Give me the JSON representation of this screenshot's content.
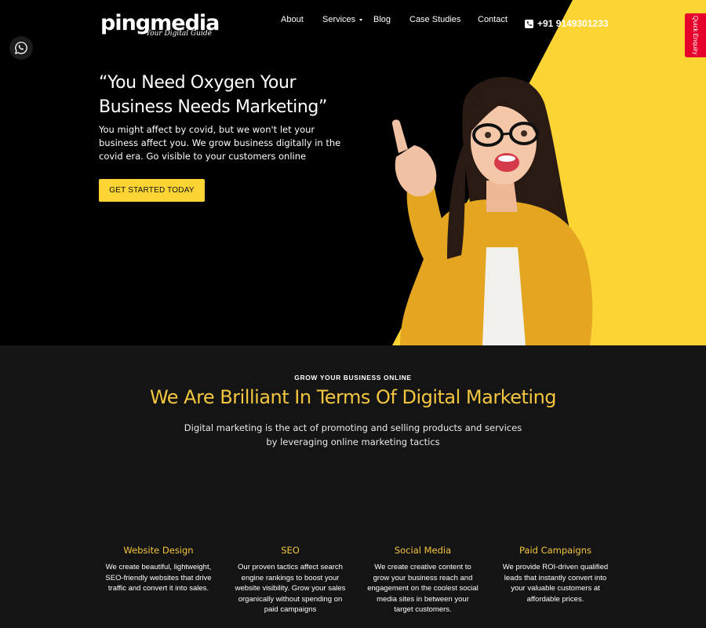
{
  "brand": {
    "name": "pingmedia",
    "tagline": "Your Digital Guide"
  },
  "nav": {
    "about": "About",
    "services": "Services",
    "blog": "Blog",
    "case_studies": "Case Studies",
    "contact": "Contact",
    "phone": "+91 9149301233"
  },
  "quick_enquiry": "Quick Enquiry",
  "hero": {
    "title": "“You Need Oxygen Your Business Needs Marketing”",
    "description": "You might affect by covid, but we won't let your business affect you. We grow business digitally in the covid era. Go visible to your customers online",
    "cta": "GET STARTED TODAY"
  },
  "section": {
    "eyebrow": "GROW YOUR BUSINESS ONLINE",
    "title": "We Are Brilliant In Terms Of Digital Marketing",
    "description": "Digital marketing is the act of promoting and selling products and services by leveraging online marketing tactics"
  },
  "services": [
    {
      "title": "Website Design",
      "text": "We create beautiful, lightweight, SEO-friendly websites that drive traffic and convert it into sales."
    },
    {
      "title": "SEO",
      "text": "Our proven tactics affect search engine rankings to boost your website visibility. Grow your sales organically without spending on paid campaigns"
    },
    {
      "title": "Social Media",
      "text": "We create creative content to grow your business reach and engagement on the coolest social media sites in between your target customers."
    },
    {
      "title": "Paid Campaigns",
      "text": "We provide ROI-driven qualified leads that instantly convert into your valuable customers at affordable prices."
    }
  ],
  "colors": {
    "accent_yellow": "#fcd535",
    "heading_yellow": "#f3c63f",
    "enquiry_red": "#e8002d",
    "hero_bg": "#000000",
    "section_bg": "#141414"
  },
  "icons": {
    "whatsapp": "whatsapp-icon",
    "phone": "phone-icon",
    "dropdown": "chevron-down-icon"
  }
}
